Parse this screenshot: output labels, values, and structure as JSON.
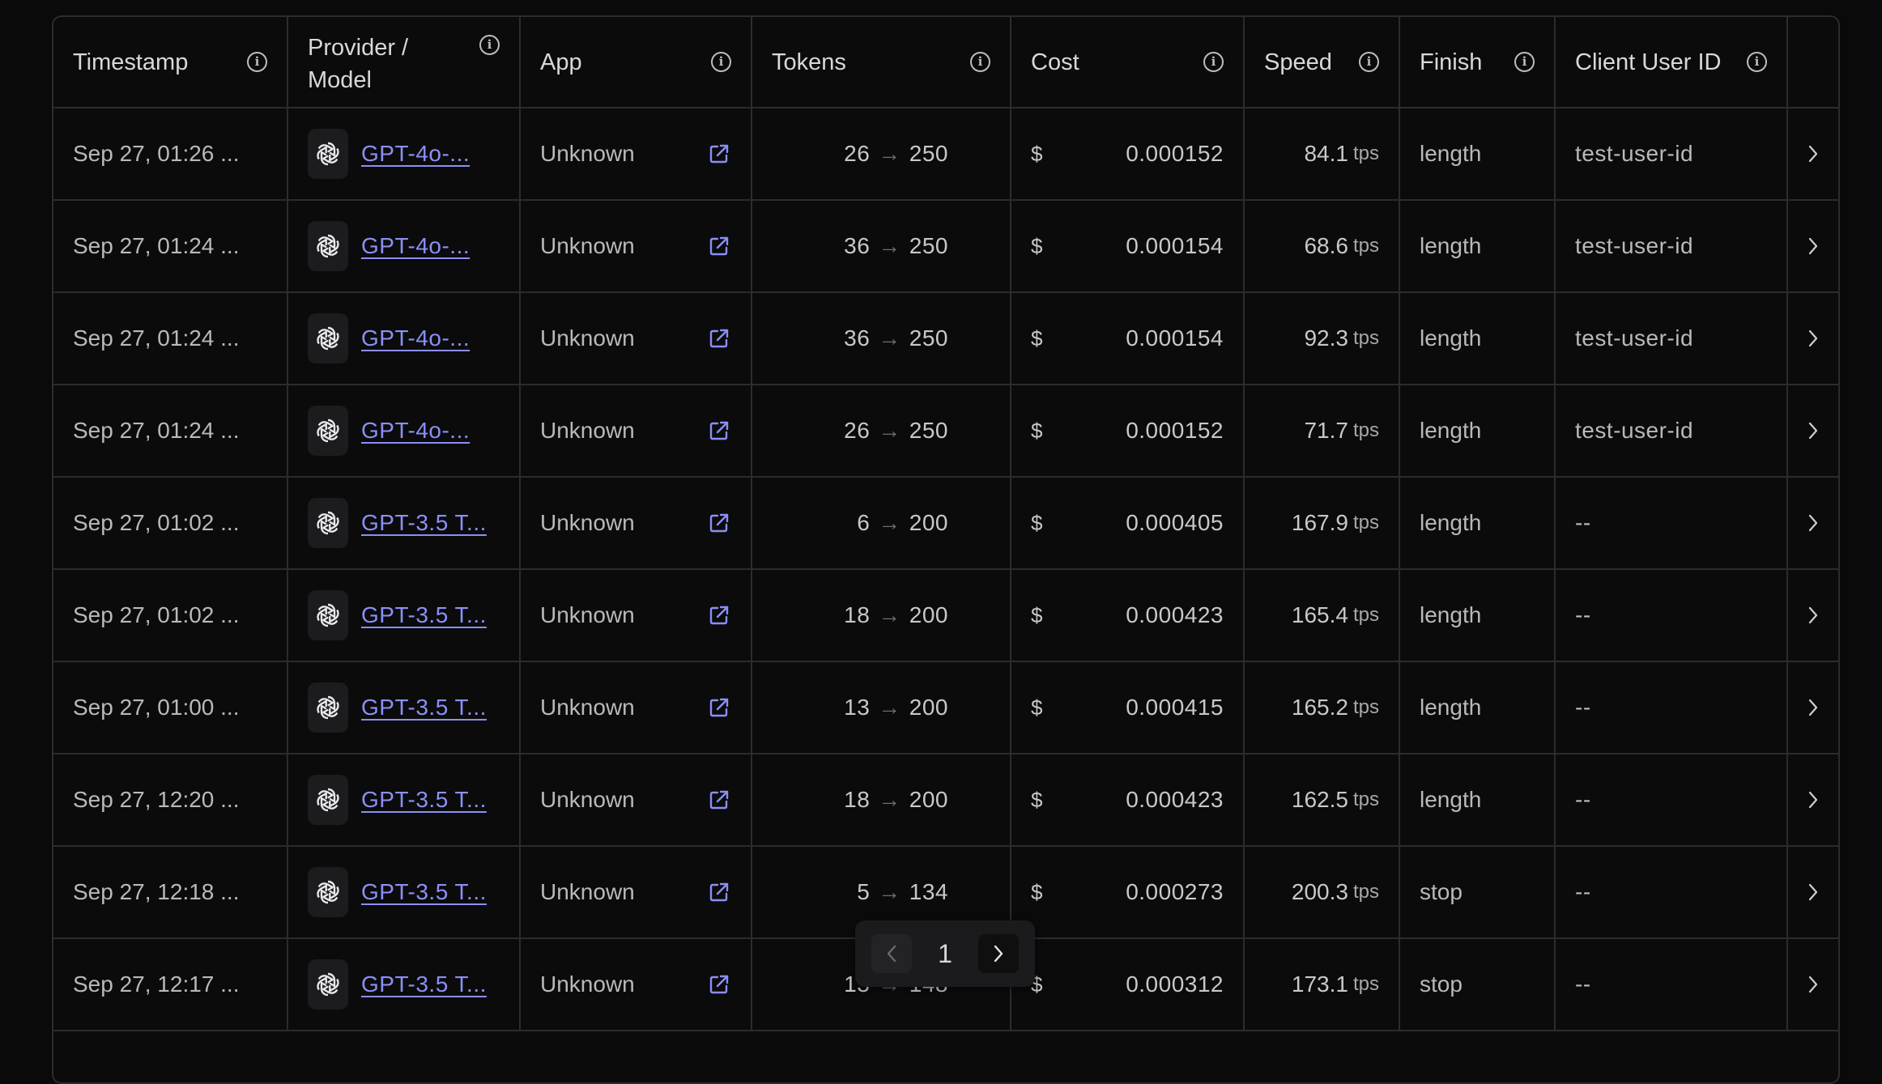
{
  "headers": {
    "timestamp": "Timestamp",
    "model": "Provider / Model",
    "app": "App",
    "tokens": "Tokens",
    "cost": "Cost",
    "speed": "Speed",
    "finish": "Finish",
    "client": "Client User ID"
  },
  "rows": [
    {
      "timestamp": "Sep 27, 01:26 ...",
      "model": "GPT-4o-...",
      "app": "Unknown",
      "tokens_in": "26",
      "tokens_out": "250",
      "cost_symbol": "$",
      "cost": "0.000152",
      "speed": "84.1",
      "speed_unit": "tps",
      "finish": "length",
      "client": "test-user-id"
    },
    {
      "timestamp": "Sep 27, 01:24 ...",
      "model": "GPT-4o-...",
      "app": "Unknown",
      "tokens_in": "36",
      "tokens_out": "250",
      "cost_symbol": "$",
      "cost": "0.000154",
      "speed": "68.6",
      "speed_unit": "tps",
      "finish": "length",
      "client": "test-user-id"
    },
    {
      "timestamp": "Sep 27, 01:24 ...",
      "model": "GPT-4o-...",
      "app": "Unknown",
      "tokens_in": "36",
      "tokens_out": "250",
      "cost_symbol": "$",
      "cost": "0.000154",
      "speed": "92.3",
      "speed_unit": "tps",
      "finish": "length",
      "client": "test-user-id"
    },
    {
      "timestamp": "Sep 27, 01:24 ...",
      "model": "GPT-4o-...",
      "app": "Unknown",
      "tokens_in": "26",
      "tokens_out": "250",
      "cost_symbol": "$",
      "cost": "0.000152",
      "speed": "71.7",
      "speed_unit": "tps",
      "finish": "length",
      "client": "test-user-id"
    },
    {
      "timestamp": "Sep 27, 01:02 ...",
      "model": "GPT-3.5 T...",
      "app": "Unknown",
      "tokens_in": "6",
      "tokens_out": "200",
      "cost_symbol": "$",
      "cost": "0.000405",
      "speed": "167.9",
      "speed_unit": "tps",
      "finish": "length",
      "client": "--"
    },
    {
      "timestamp": "Sep 27, 01:02 ...",
      "model": "GPT-3.5 T...",
      "app": "Unknown",
      "tokens_in": "18",
      "tokens_out": "200",
      "cost_symbol": "$",
      "cost": "0.000423",
      "speed": "165.4",
      "speed_unit": "tps",
      "finish": "length",
      "client": "--"
    },
    {
      "timestamp": "Sep 27, 01:00 ...",
      "model": "GPT-3.5 T...",
      "app": "Unknown",
      "tokens_in": "13",
      "tokens_out": "200",
      "cost_symbol": "$",
      "cost": "0.000415",
      "speed": "165.2",
      "speed_unit": "tps",
      "finish": "length",
      "client": "--"
    },
    {
      "timestamp": "Sep 27, 12:20 ...",
      "model": "GPT-3.5 T...",
      "app": "Unknown",
      "tokens_in": "18",
      "tokens_out": "200",
      "cost_symbol": "$",
      "cost": "0.000423",
      "speed": "162.5",
      "speed_unit": "tps",
      "finish": "length",
      "client": "--"
    },
    {
      "timestamp": "Sep 27, 12:18 ...",
      "model": "GPT-3.5 T...",
      "app": "Unknown",
      "tokens_in": "5",
      "tokens_out": "134",
      "cost_symbol": "$",
      "cost": "0.000273",
      "speed": "200.3",
      "speed_unit": "tps",
      "finish": "stop",
      "client": "--"
    },
    {
      "timestamp": "Sep 27, 12:17 ...",
      "model": "GPT-3.5 T...",
      "app": "Unknown",
      "tokens_in": "13",
      "tokens_out": "148",
      "cost_symbol": "$",
      "cost": "0.000312",
      "speed": "173.1",
      "speed_unit": "tps",
      "finish": "stop",
      "client": "--"
    }
  ],
  "pagination": {
    "page": "1"
  },
  "colors": {
    "link": "#8b8ff5",
    "border": "#2c2c2f",
    "background": "#0a0a0b"
  }
}
